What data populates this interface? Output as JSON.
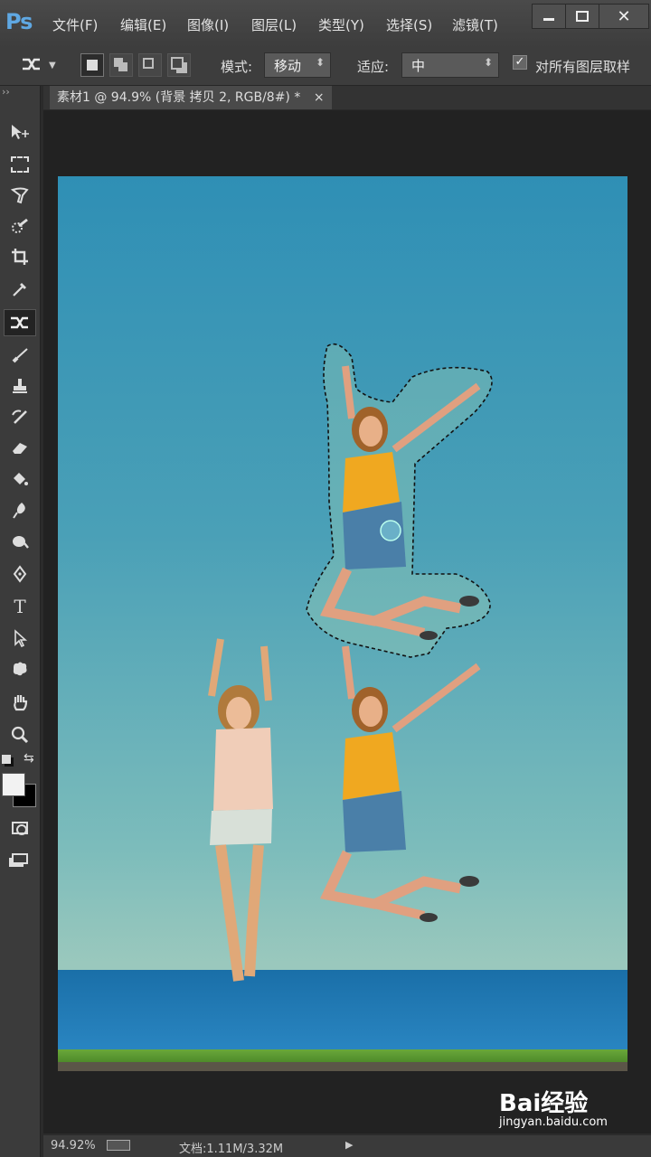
{
  "app": {
    "logo": "Ps"
  },
  "menu": [
    "文件(F)",
    "编辑(E)",
    "图像(I)",
    "图层(L)",
    "类型(Y)",
    "选择(S)",
    "滤镜(T)"
  ],
  "window_buttons": [
    "minimize",
    "restore",
    "close"
  ],
  "options": {
    "mode_label": "模式:",
    "mode_value": "移动",
    "adapt_label": "适应:",
    "adapt_value": "中",
    "sample_all_layers_label": "对所有图层取样",
    "sample_all_layers_checked": true
  },
  "document": {
    "tab_title": "素材1 @ 94.9% (背景 拷贝 2, RGB/8#) *",
    "close_symbol": "×"
  },
  "toolbar": {
    "collapse": "››",
    "tools": [
      "move-tool-icon",
      "marquee-tool-icon",
      "lasso-tool-icon",
      "quick-select-tool-icon",
      "crop-tool-icon",
      "eyedropper-tool-icon",
      "content-aware-move-tool-icon",
      "brush-tool-icon",
      "stamp-tool-icon",
      "history-brush-tool-icon",
      "eraser-tool-icon",
      "paint-bucket-tool-icon",
      "blur-tool-icon",
      "dodge-tool-icon",
      "pen-tool-icon",
      "type-tool-icon",
      "path-select-tool-icon",
      "shape-tool-icon",
      "hand-tool-icon",
      "zoom-tool-icon"
    ],
    "active_tool": "content-aware-move-tool-icon",
    "type_glyph": "T",
    "foreground_color": "#f2f2f2",
    "background_color": "#000000"
  },
  "status": {
    "zoom": "94.92%",
    "doc_info": "文档:1.11M/3.32M"
  },
  "watermark": {
    "logo": "Bai经验",
    "url": "jingyan.baidu.com"
  },
  "colors": {
    "sky": "#3a95b8",
    "shirt_yellow": "#f0a820",
    "shorts_blue": "#4a7fa8",
    "sea": "#1a6fa8"
  }
}
